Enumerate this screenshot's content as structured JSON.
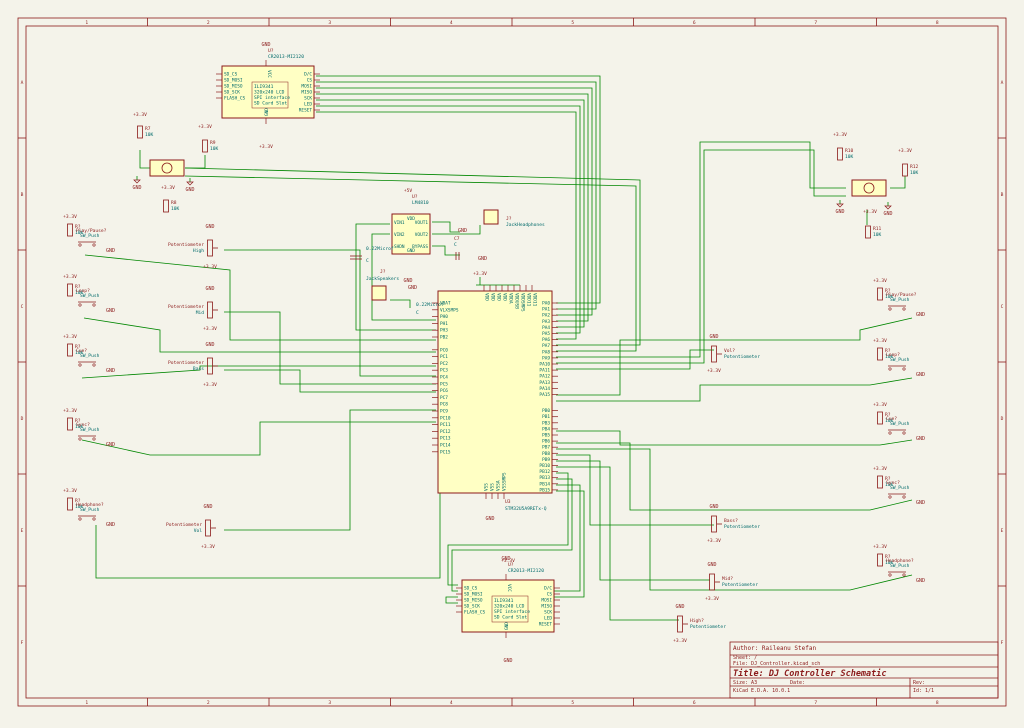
{
  "border": {
    "columns": [
      "1",
      "2",
      "3",
      "4",
      "5",
      "6",
      "7",
      "8"
    ],
    "rows": [
      "A",
      "B",
      "C",
      "D",
      "E",
      "F"
    ]
  },
  "title_block": {
    "author": "Author: Raileanu Stefan",
    "sheet": "Sheet: /",
    "file": "File: DJ_Controller.kicad_sch",
    "title": "Title: DJ Controller Schematic",
    "size": "Size: A3",
    "date": "Date:",
    "rev": "Rev:",
    "kicad": "KiCad E.D.A. 10.0.1",
    "id": "Id: 1/1"
  },
  "power": {
    "v33": "+3.3V",
    "gnd": "GND",
    "v5": "+5V"
  },
  "mcu": {
    "ref": "U3",
    "value": "STM32U5A9RETx-Q",
    "left_pins": [
      "VBAT",
      "VLXSMPS",
      "PH0",
      "PH1",
      "PH3",
      "PB2",
      "PC0",
      "PC1",
      "PC2",
      "PC3",
      "PC4",
      "PC5",
      "PC6",
      "PC7",
      "PC8",
      "PC9",
      "PC10",
      "PC11",
      "PC12",
      "PC13",
      "PC14",
      "PC15"
    ],
    "right_pins": [
      "PA0",
      "PA1",
      "PA2",
      "PA3",
      "PA4",
      "PA5",
      "PA6",
      "PA7",
      "PA8",
      "PA9",
      "PA10",
      "PA11",
      "PA12",
      "PA13",
      "PA14",
      "PA15",
      "PB0",
      "PB1",
      "PB3",
      "PB4",
      "PB5",
      "PB6",
      "PB7",
      "PB8",
      "PB9",
      "PB10",
      "PB12",
      "PB13",
      "PB14",
      "PB15"
    ],
    "top_pins": [
      "VDD",
      "VDD",
      "VDD",
      "VDD",
      "VDDA",
      "VDDUSB",
      "VDDSMPS",
      "VDD11",
      "VDD11"
    ],
    "bottom_pins": [
      "VSS",
      "VSS",
      "VSSA",
      "VSSSMPS"
    ]
  },
  "lcd_top": {
    "ref": "U?",
    "value": "CR2013-MI2120",
    "left_pins": [
      "SD_CS",
      "SD_MOSI",
      "SD_MISO",
      "SD_SCK",
      "FLASH_CS"
    ],
    "right_pins": [
      "D/C",
      "CS",
      "MOSI",
      "MISO",
      "SCK",
      "LED",
      "RESET"
    ],
    "label": [
      "ILI9341",
      "320x240 LCD",
      "SPI interface",
      "SD Card Slot"
    ],
    "vcc": "VCC",
    "gnd": "GND"
  },
  "lcd_bottom": {
    "ref": "U?",
    "value": "CR2013-MI2120",
    "left_pins": [
      "SD_CS",
      "SD_MOSI",
      "SD_MISO",
      "SD_SCK",
      "FLASH_CS"
    ],
    "right_pins": [
      "D/C",
      "CS",
      "MOSI",
      "MISO",
      "SCK",
      "LED",
      "RESET"
    ],
    "label": [
      "ILI9341",
      "320x240 LCD",
      "SPI interface",
      "SD Card Slot"
    ],
    "vcc": "VCC",
    "gnd": "GND"
  },
  "amp": {
    "ref": "U?",
    "value": "LM4810",
    "pins": [
      "VIN1",
      "VIN2",
      "SHDN",
      "VOUT1",
      "VOUT2",
      "BYPASS",
      "VDD",
      "GND"
    ],
    "c7": "C7",
    "c": "C",
    "c_in": "0.22Microf",
    "c_in2": "0.22Microf",
    "cap": "C"
  },
  "jacks": {
    "phones_ref": "J?",
    "phones": "JackHeadphones",
    "spk_ref": "J?",
    "spk": "JackSpeakers"
  },
  "encoders_left": {
    "r7": "R7",
    "r7v": "10K",
    "r8": "R8",
    "r8v": "10K",
    "r9": "R9",
    "r9v": "10K"
  },
  "encoders_right": {
    "r10": "R10",
    "r10v": "10K",
    "r11": "R11",
    "r11v": "10K",
    "r12": "R12",
    "r12v": "10K"
  },
  "buttons_left": [
    {
      "ref": "R?",
      "val": "10K",
      "name": "Play/Pause?",
      "type": "SW_Push"
    },
    {
      "ref": "R?",
      "val": "10K",
      "name": "Loop?",
      "type": "SW_Push"
    },
    {
      "ref": "R?",
      "val": "10K",
      "name": "Cue?",
      "type": "SW_Push"
    },
    {
      "ref": "R?",
      "val": "10K",
      "name": "Sync?",
      "type": "SW_Push"
    },
    {
      "ref": "R?",
      "val": "10K",
      "name": "Headphone?",
      "type": "SW_Push"
    }
  ],
  "buttons_right": [
    {
      "ref": "R?",
      "val": "10K",
      "name": "Play/Pause?",
      "type": "SW_Push"
    },
    {
      "ref": "R?",
      "val": "10K",
      "name": "Loop?",
      "type": "SW_Push"
    },
    {
      "ref": "R?",
      "val": "10K",
      "name": "Cue?",
      "type": "SW_Push"
    },
    {
      "ref": "R?",
      "val": "10K",
      "name": "Sync?",
      "type": "SW_Push"
    },
    {
      "ref": "R?",
      "val": "10K",
      "name": "Headphone?",
      "type": "SW_Push"
    }
  ],
  "pots_left": [
    {
      "ref": "Potentiometer",
      "name": "High"
    },
    {
      "ref": "Potentiometer",
      "name": "Mid"
    },
    {
      "ref": "Potentiometer",
      "name": "Bass"
    },
    {
      "ref": "Potentiometer",
      "name": "Vol"
    }
  ],
  "pots_right": [
    {
      "ref": "Vol?",
      "name": "Potentiometer"
    },
    {
      "ref": "Bass?",
      "name": "Potentiometer"
    },
    {
      "ref": "Mid?",
      "name": "Potentiometer"
    },
    {
      "ref": "High?",
      "name": "Potentiometer"
    }
  ]
}
